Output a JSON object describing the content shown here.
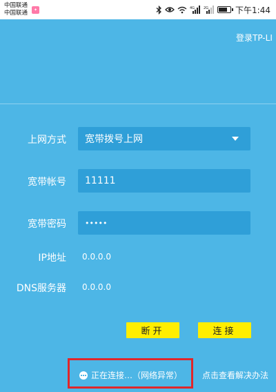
{
  "status_bar": {
    "carrier_1": "中国联通",
    "carrier_2": "中国联通",
    "time": "下午1:44",
    "signal_1": "4G",
    "signal_2": "2G",
    "battery_level": 0.8
  },
  "header": {
    "login_link": "登录TP-LI"
  },
  "form": {
    "mode_label": "上网方式",
    "mode_value": "宽带拨号上网",
    "account_label": "宽带帐号",
    "account_value": "11111",
    "password_label": "宽带密码",
    "password_value": "•••••",
    "ip_label": "IP地址",
    "ip_value": "0.0.0.0",
    "dns_label": "DNS服务器",
    "dns_value": "0.0.0.0"
  },
  "buttons": {
    "disconnect": "断开",
    "connect": "连接"
  },
  "status": {
    "message": "正在连接…（网络异常）",
    "help_link": "点击查看解决办法"
  },
  "colors": {
    "background": "#4db6e6",
    "field": "#2f9fd8",
    "button": "#ffee00",
    "highlight_border": "#e0262a"
  }
}
